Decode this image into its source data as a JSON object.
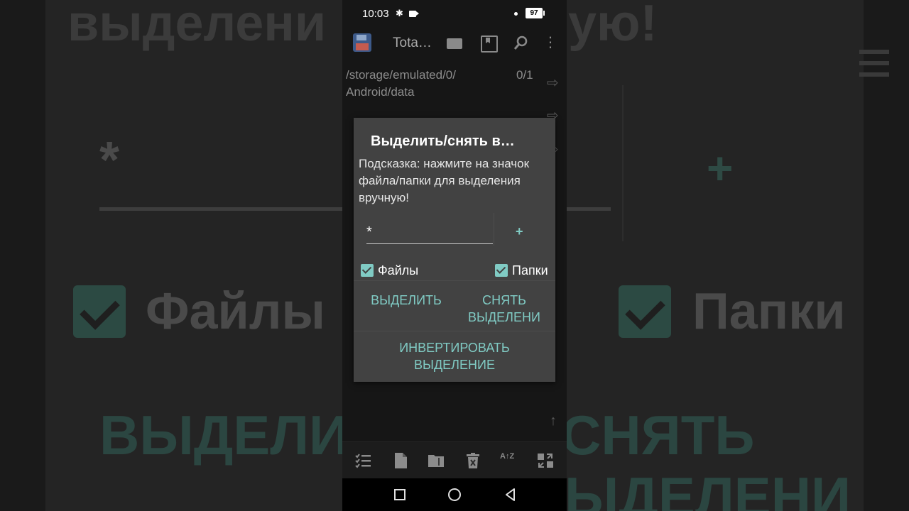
{
  "background": {
    "title_fragment": "выделени",
    "title_fragment_right": "ую!",
    "pattern": "*",
    "plus": "+",
    "files": "Файлы",
    "folders": "Папки",
    "select": "ВЫДЕЛИ",
    "deselect": "СНЯТЬ",
    "deselect2": "ЫДЕЛЕНИ"
  },
  "status_bar": {
    "time": "10:03",
    "bluetooth": "✱",
    "battery": "97"
  },
  "toolbar": {
    "title": "Tota…",
    "search_glyph": "⌕",
    "more_glyph": "⋮"
  },
  "path_bar": {
    "path": "/storage/emulated/0/ Android/data",
    "count": "0/1",
    "arrow": "⇨",
    "up_arrow": "↑"
  },
  "dialog": {
    "title": "Выделить/снять в…",
    "hint": "Подсказка: нажмите на значок файла/папки для выделения вручную!",
    "pattern_value": "*",
    "add_label": "+",
    "files_label": "Файлы",
    "files_checked": true,
    "folders_label": "Папки",
    "folders_checked": true,
    "select_button": "ВЫДЕЛИТЬ",
    "deselect_button_line1": "СНЯТЬ",
    "deselect_button_line2": "ВЫДЕЛЕНИ",
    "invert_button_line1": "ИНВЕРТИРОВАТЬ",
    "invert_button_line2": "ВЫДЕЛЕНИЕ"
  },
  "bottom_bar": {
    "icons": [
      "select-list-icon",
      "file-icon",
      "zip-folder-icon",
      "delete-icon",
      "sort-az-icon",
      "swap-panels-icon"
    ],
    "sort_glyph": "A↑Z"
  },
  "colors": {
    "accent": "#80cbc4",
    "dialog_bg": "#424242",
    "background": "#161616"
  }
}
